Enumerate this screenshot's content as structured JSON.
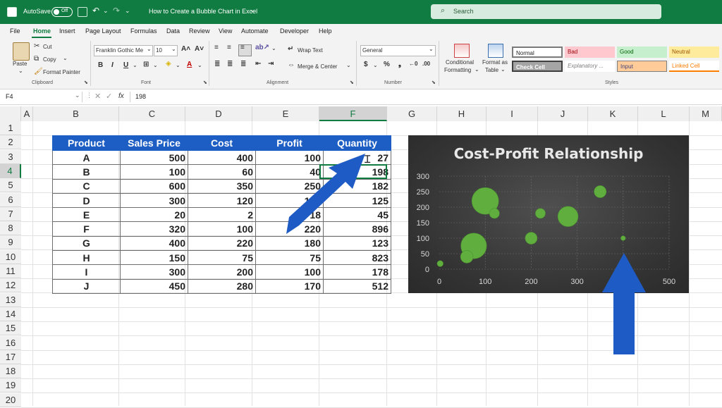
{
  "titlebar": {
    "autosave_label": "AutoSave",
    "autosave_state": "Off",
    "doc_title": "How to Create a Bubble Chart in Excel",
    "search_placeholder": "Search"
  },
  "menu": [
    "File",
    "Home",
    "Insert",
    "Page Layout",
    "Formulas",
    "Data",
    "Review",
    "View",
    "Automate",
    "Developer",
    "Help"
  ],
  "ribbon": {
    "clipboard": {
      "paste": "Paste",
      "cut": "Cut",
      "copy": "Copy",
      "format_painter": "Format Painter",
      "group": "Clipboard"
    },
    "font": {
      "name": "Franklin Gothic Me",
      "size": "10",
      "group": "Font"
    },
    "alignment": {
      "wrap": "Wrap Text",
      "merge": "Merge & Center",
      "group": "Alignment"
    },
    "number": {
      "format": "General",
      "group": "Number"
    },
    "styles_buttons": {
      "conditional": "Conditional",
      "formatting": "Formatting",
      "format_as": "Format as",
      "table": "Table"
    },
    "styles": {
      "normal": "Normal",
      "bad": "Bad",
      "good": "Good",
      "neutral": "Neutral",
      "check_cell": "Check Cell",
      "explanatory": "Explanatory ...",
      "input": "Input",
      "linked_cell": "Linked Cell",
      "group": "Styles"
    }
  },
  "formula_bar": {
    "cell_ref": "F4",
    "fx": "fx",
    "value": "198"
  },
  "columns": [
    "A",
    "B",
    "C",
    "D",
    "E",
    "F",
    "G",
    "H",
    "I",
    "J",
    "K",
    "L",
    "M"
  ],
  "rows": [
    "1",
    "2",
    "3",
    "4",
    "5",
    "6",
    "7",
    "8",
    "9",
    "10",
    "11",
    "12",
    "13",
    "14",
    "15",
    "16",
    "17",
    "18",
    "19",
    "20"
  ],
  "table": {
    "headers": [
      "Product",
      "Sales Price",
      "Cost",
      "Profit",
      "Quantity"
    ],
    "rows": [
      [
        "A",
        "500",
        "400",
        "100",
        "27"
      ],
      [
        "B",
        "100",
        "60",
        "40",
        "198"
      ],
      [
        "C",
        "600",
        "350",
        "250",
        "182"
      ],
      [
        "D",
        "300",
        "120",
        "180",
        "125"
      ],
      [
        "E",
        "20",
        "2",
        "18",
        "45"
      ],
      [
        "F",
        "320",
        "100",
        "220",
        "896"
      ],
      [
        "G",
        "400",
        "220",
        "180",
        "123"
      ],
      [
        "H",
        "150",
        "75",
        "75",
        "823"
      ],
      [
        "I",
        "300",
        "200",
        "100",
        "178"
      ],
      [
        "J",
        "450",
        "280",
        "170",
        "512"
      ]
    ]
  },
  "chart_data": {
    "type": "bubble",
    "title": "Cost-Profit Relationship",
    "xlim": [
      0,
      500
    ],
    "ylim": [
      0,
      300
    ],
    "xticks": [
      "0",
      "100",
      "200",
      "300",
      "500"
    ],
    "yticks": [
      "0",
      "50",
      "100",
      "150",
      "200",
      "250",
      "300"
    ],
    "points": [
      {
        "x": 400,
        "y": 100,
        "size": 27
      },
      {
        "x": 60,
        "y": 40,
        "size": 198
      },
      {
        "x": 350,
        "y": 250,
        "size": 182
      },
      {
        "x": 120,
        "y": 180,
        "size": 125
      },
      {
        "x": 2,
        "y": 18,
        "size": 45
      },
      {
        "x": 100,
        "y": 220,
        "size": 896
      },
      {
        "x": 220,
        "y": 180,
        "size": 123
      },
      {
        "x": 75,
        "y": 75,
        "size": 823
      },
      {
        "x": 200,
        "y": 100,
        "size": 178
      },
      {
        "x": 280,
        "y": 170,
        "size": 512
      }
    ],
    "bubble_color": "#5fae3e"
  },
  "colors": {
    "excel_green": "#107c41",
    "header_blue": "#1d5ec5",
    "arrow_blue": "#1f5bc4"
  }
}
